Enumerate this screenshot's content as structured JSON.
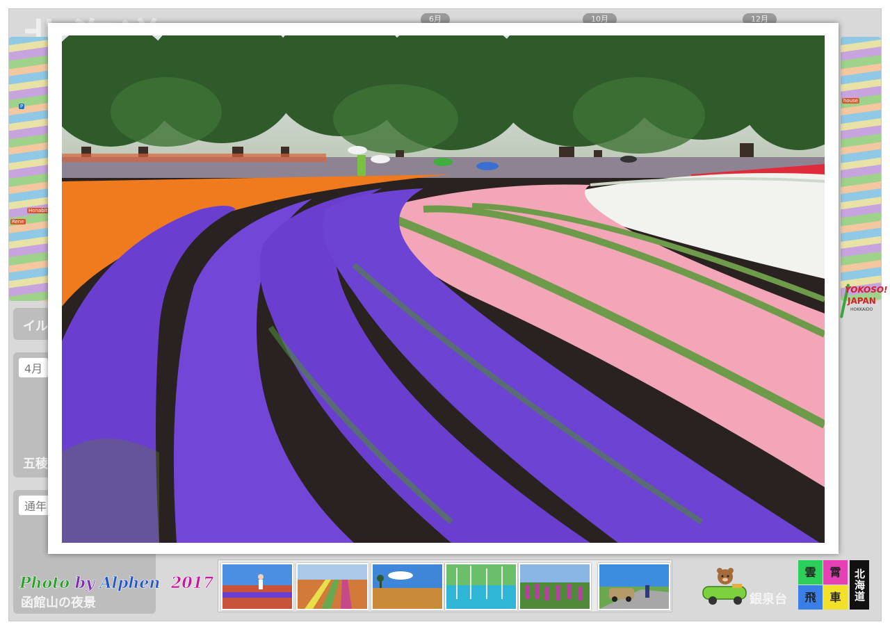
{
  "background": {
    "title": "北海道",
    "tabs": [
      "6月",
      "10月",
      "12月"
    ],
    "cards": [
      {
        "badge": "",
        "caption": "イル"
      },
      {
        "badge": "4月",
        "caption": "五稜"
      },
      {
        "badge": "通年",
        "caption": ""
      }
    ],
    "bottom_left_caption": "函館山の夜景",
    "bottom_right_caption": "銀泉台"
  },
  "map_tags": [
    "P",
    "Honabito",
    "Rene",
    "house"
  ],
  "logo_badge": {
    "line1": "YOKOSO!",
    "line2": "JAPAN",
    "line3": "HOKKAIDO"
  },
  "credit": {
    "photo": "Photo",
    "by": "by",
    "name": "Alphen",
    "year": "2017"
  },
  "thumbnails": [
    {
      "name": "thumb-girl-flower-field",
      "sky": "#4a8fe0",
      "ground": "#c8543a"
    },
    {
      "name": "thumb-striped-flower-rows",
      "sky": "#aac8e8",
      "ground": "#d27a3a"
    },
    {
      "name": "thumb-golden-field-tree",
      "sky": "#3f86d8",
      "ground": "#c98a3a"
    },
    {
      "name": "thumb-blue-pond",
      "sky": "#6bbf6b",
      "ground": "#2fb5d6"
    },
    {
      "name": "thumb-lupine-field",
      "sky": "#8ab6e6",
      "ground": "#b63fa0"
    },
    {
      "name": "thumb-car-road",
      "sky": "#3c8ce0",
      "ground": "#a7a7a7"
    }
  ],
  "kanji_logo": {
    "cells": [
      "雲",
      "霄",
      "飛",
      "車"
    ],
    "vertical": "北海道"
  },
  "colors": {
    "purple_flower": "#6a3fd0",
    "orange_flower": "#f07a1e",
    "pink_flower": "#f3a6b8",
    "white_flower": "#f2f2ee",
    "red_flower": "#e02b3b",
    "tree_green": "#2f5a2a"
  }
}
